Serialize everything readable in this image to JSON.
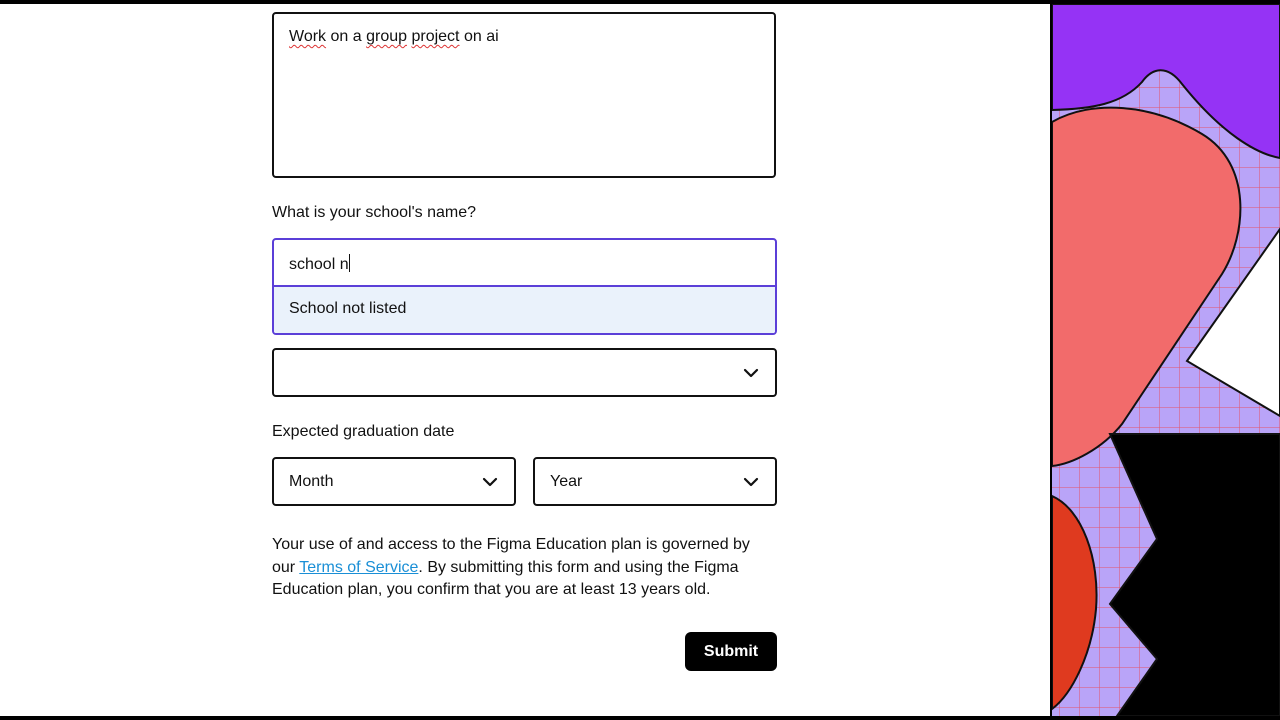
{
  "form": {
    "project_description_value": [
      "Work",
      "on a",
      "group",
      "project",
      "on ai"
    ],
    "school_question": "What is your school's name?",
    "school_input_value": "school n",
    "school_suggestion": "School not listed",
    "extra_select_value": "",
    "graduation_label": "Expected graduation date",
    "month_placeholder": "Month",
    "year_placeholder": "Year"
  },
  "legal": {
    "text_before": "Your use of and access to the Figma Education plan is governed by our ",
    "link_text": "Terms of Service",
    "text_after": ". By submitting this form and using the Figma Education plan, you confirm that you are at least 13 years old."
  },
  "submit_label": "Submit",
  "icons": {
    "select_chevron": "chevron-down-icon"
  },
  "colors": {
    "focus_border": "#5b3fd8",
    "suggestion_bg": "#eaf2fb",
    "link": "#1a8fd6",
    "art_purple": "#9533f5",
    "art_lavender": "#b9a4f8",
    "art_coral": "#f26b6b",
    "art_red": "#df3a1f"
  }
}
